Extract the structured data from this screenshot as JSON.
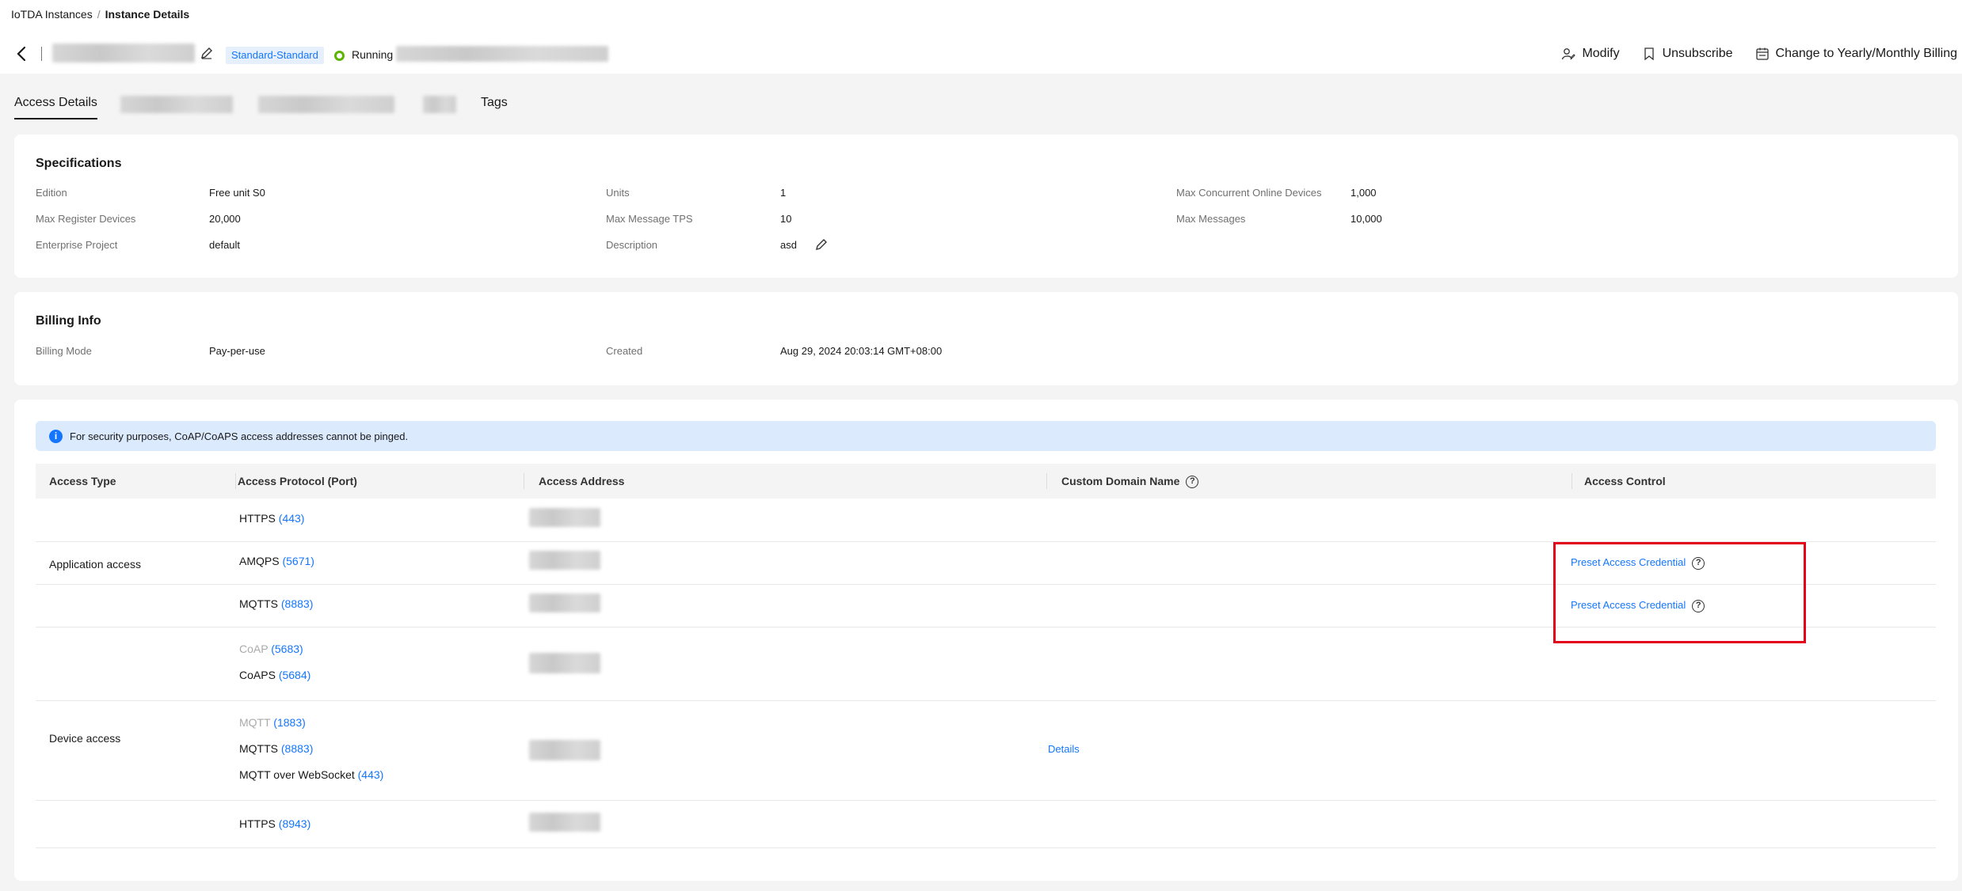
{
  "breadcrumb": {
    "parent": "IoTDA Instances",
    "current": "Instance Details"
  },
  "instance": {
    "edition_badge": "Standard-Standard",
    "status": "Running"
  },
  "actions": {
    "modify": "Modify",
    "unsubscribe": "Unsubscribe",
    "change_billing": "Change to Yearly/Monthly Billing"
  },
  "tabs": {
    "access_details": "Access Details",
    "tags": "Tags"
  },
  "specifications": {
    "title": "Specifications",
    "edition_label": "Edition",
    "edition_value": "Free unit S0",
    "units_label": "Units",
    "units_value": "1",
    "max_online_label": "Max Concurrent Online Devices",
    "max_online_value": "1,000",
    "max_register_label": "Max Register Devices",
    "max_register_value": "20,000",
    "max_tps_label": "Max Message TPS",
    "max_tps_value": "10",
    "max_messages_label": "Max Messages",
    "max_messages_value": "10,000",
    "enterprise_label": "Enterprise Project",
    "enterprise_value": "default",
    "description_label": "Description",
    "description_value": "asd"
  },
  "billing": {
    "title": "Billing Info",
    "mode_label": "Billing Mode",
    "mode_value": "Pay-per-use",
    "created_label": "Created",
    "created_value": "Aug 29, 2024 20:03:14 GMT+08:00"
  },
  "access": {
    "notice": "For security purposes, CoAP/CoAPS access addresses cannot be pinged.",
    "headers": {
      "type": "Access Type",
      "protocol": "Access Protocol (Port)",
      "address": "Access Address",
      "domain": "Custom Domain Name",
      "control": "Access Control"
    },
    "application_access": "Application access",
    "device_access": "Device access",
    "protocols": {
      "https1": {
        "name": "HTTPS",
        "port": "(443)"
      },
      "amqps": {
        "name": "AMQPS",
        "port": "(5671)"
      },
      "mqtts1": {
        "name": "MQTTS",
        "port": "(8883)"
      },
      "coap": {
        "name": "CoAP",
        "port": "(5683)"
      },
      "coaps": {
        "name": "CoAPS",
        "port": "(5684)"
      },
      "mqtt": {
        "name": "MQTT",
        "port": "(1883)"
      },
      "mqtts2": {
        "name": "MQTTS",
        "port": "(8883)"
      },
      "mqtt_ws": {
        "name": "MQTT over WebSocket",
        "port": "(443)"
      },
      "https2": {
        "name": "HTTPS",
        "port": "(8943)"
      }
    },
    "preset_credential": "Preset Access Credential",
    "details_link": "Details"
  },
  "colors": {
    "accent": "#1476ff",
    "running": "#5cb300",
    "highlight": "#e3001b"
  }
}
